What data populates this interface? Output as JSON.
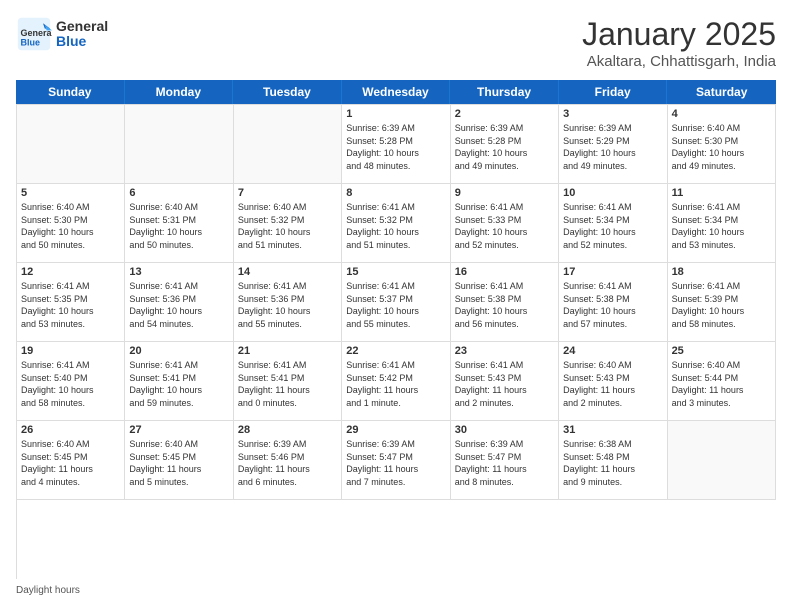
{
  "header": {
    "logo_general": "General",
    "logo_blue": "Blue",
    "month_title": "January 2025",
    "location": "Akaltara, Chhattisgarh, India"
  },
  "days_of_week": [
    "Sunday",
    "Monday",
    "Tuesday",
    "Wednesday",
    "Thursday",
    "Friday",
    "Saturday"
  ],
  "weeks": [
    [
      {
        "num": "",
        "info": ""
      },
      {
        "num": "",
        "info": ""
      },
      {
        "num": "",
        "info": ""
      },
      {
        "num": "1",
        "info": "Sunrise: 6:39 AM\nSunset: 5:28 PM\nDaylight: 10 hours\nand 48 minutes."
      },
      {
        "num": "2",
        "info": "Sunrise: 6:39 AM\nSunset: 5:28 PM\nDaylight: 10 hours\nand 49 minutes."
      },
      {
        "num": "3",
        "info": "Sunrise: 6:39 AM\nSunset: 5:29 PM\nDaylight: 10 hours\nand 49 minutes."
      },
      {
        "num": "4",
        "info": "Sunrise: 6:40 AM\nSunset: 5:30 PM\nDaylight: 10 hours\nand 49 minutes."
      }
    ],
    [
      {
        "num": "5",
        "info": "Sunrise: 6:40 AM\nSunset: 5:30 PM\nDaylight: 10 hours\nand 50 minutes."
      },
      {
        "num": "6",
        "info": "Sunrise: 6:40 AM\nSunset: 5:31 PM\nDaylight: 10 hours\nand 50 minutes."
      },
      {
        "num": "7",
        "info": "Sunrise: 6:40 AM\nSunset: 5:32 PM\nDaylight: 10 hours\nand 51 minutes."
      },
      {
        "num": "8",
        "info": "Sunrise: 6:41 AM\nSunset: 5:32 PM\nDaylight: 10 hours\nand 51 minutes."
      },
      {
        "num": "9",
        "info": "Sunrise: 6:41 AM\nSunset: 5:33 PM\nDaylight: 10 hours\nand 52 minutes."
      },
      {
        "num": "10",
        "info": "Sunrise: 6:41 AM\nSunset: 5:34 PM\nDaylight: 10 hours\nand 52 minutes."
      },
      {
        "num": "11",
        "info": "Sunrise: 6:41 AM\nSunset: 5:34 PM\nDaylight: 10 hours\nand 53 minutes."
      }
    ],
    [
      {
        "num": "12",
        "info": "Sunrise: 6:41 AM\nSunset: 5:35 PM\nDaylight: 10 hours\nand 53 minutes."
      },
      {
        "num": "13",
        "info": "Sunrise: 6:41 AM\nSunset: 5:36 PM\nDaylight: 10 hours\nand 54 minutes."
      },
      {
        "num": "14",
        "info": "Sunrise: 6:41 AM\nSunset: 5:36 PM\nDaylight: 10 hours\nand 55 minutes."
      },
      {
        "num": "15",
        "info": "Sunrise: 6:41 AM\nSunset: 5:37 PM\nDaylight: 10 hours\nand 55 minutes."
      },
      {
        "num": "16",
        "info": "Sunrise: 6:41 AM\nSunset: 5:38 PM\nDaylight: 10 hours\nand 56 minutes."
      },
      {
        "num": "17",
        "info": "Sunrise: 6:41 AM\nSunset: 5:38 PM\nDaylight: 10 hours\nand 57 minutes."
      },
      {
        "num": "18",
        "info": "Sunrise: 6:41 AM\nSunset: 5:39 PM\nDaylight: 10 hours\nand 58 minutes."
      }
    ],
    [
      {
        "num": "19",
        "info": "Sunrise: 6:41 AM\nSunset: 5:40 PM\nDaylight: 10 hours\nand 58 minutes."
      },
      {
        "num": "20",
        "info": "Sunrise: 6:41 AM\nSunset: 5:41 PM\nDaylight: 10 hours\nand 59 minutes."
      },
      {
        "num": "21",
        "info": "Sunrise: 6:41 AM\nSunset: 5:41 PM\nDaylight: 11 hours\nand 0 minutes."
      },
      {
        "num": "22",
        "info": "Sunrise: 6:41 AM\nSunset: 5:42 PM\nDaylight: 11 hours\nand 1 minute."
      },
      {
        "num": "23",
        "info": "Sunrise: 6:41 AM\nSunset: 5:43 PM\nDaylight: 11 hours\nand 2 minutes."
      },
      {
        "num": "24",
        "info": "Sunrise: 6:40 AM\nSunset: 5:43 PM\nDaylight: 11 hours\nand 2 minutes."
      },
      {
        "num": "25",
        "info": "Sunrise: 6:40 AM\nSunset: 5:44 PM\nDaylight: 11 hours\nand 3 minutes."
      }
    ],
    [
      {
        "num": "26",
        "info": "Sunrise: 6:40 AM\nSunset: 5:45 PM\nDaylight: 11 hours\nand 4 minutes."
      },
      {
        "num": "27",
        "info": "Sunrise: 6:40 AM\nSunset: 5:45 PM\nDaylight: 11 hours\nand 5 minutes."
      },
      {
        "num": "28",
        "info": "Sunrise: 6:39 AM\nSunset: 5:46 PM\nDaylight: 11 hours\nand 6 minutes."
      },
      {
        "num": "29",
        "info": "Sunrise: 6:39 AM\nSunset: 5:47 PM\nDaylight: 11 hours\nand 7 minutes."
      },
      {
        "num": "30",
        "info": "Sunrise: 6:39 AM\nSunset: 5:47 PM\nDaylight: 11 hours\nand 8 minutes."
      },
      {
        "num": "31",
        "info": "Sunrise: 6:38 AM\nSunset: 5:48 PM\nDaylight: 11 hours\nand 9 minutes."
      },
      {
        "num": "",
        "info": ""
      }
    ]
  ],
  "footer": {
    "daylight_hours": "Daylight hours"
  }
}
